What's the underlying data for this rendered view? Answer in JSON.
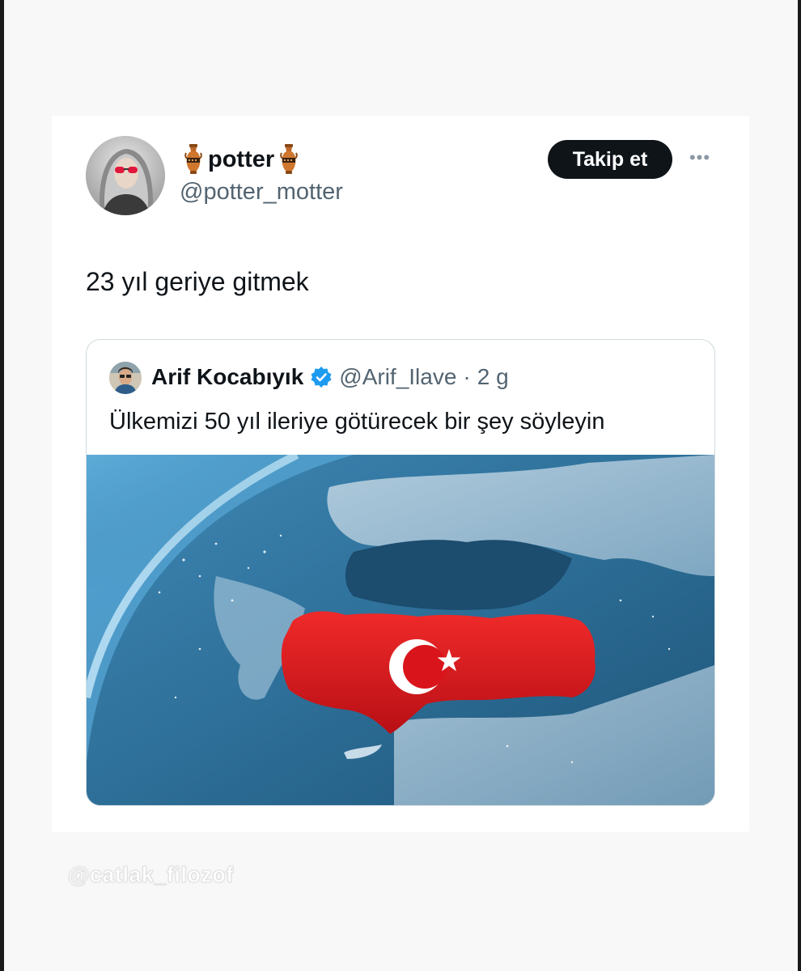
{
  "tweet": {
    "author": {
      "display_name": "potter",
      "handle": "@potter_motter",
      "name_emoji": "amphora"
    },
    "follow_label": "Takip et",
    "more_icon": "more-horizontal-icon",
    "text": "23 yıl geriye gitmek",
    "quoted": {
      "display_name": "Arif Kocabıyık",
      "verified": true,
      "verified_color": "#1d9bf0",
      "handle": "@Arif_Ilave",
      "separator": "·",
      "time": "2 g",
      "text": "Ülkemizi 50 yıl ileriye götürecek bir şey söyleyin",
      "image": "map-of-turkey-with-flag-from-space"
    }
  },
  "watermark": "@catlak_filozof",
  "colors": {
    "follow_button_bg": "#0f1419",
    "secondary_text": "#536471",
    "flag_red": "#d9141b"
  }
}
